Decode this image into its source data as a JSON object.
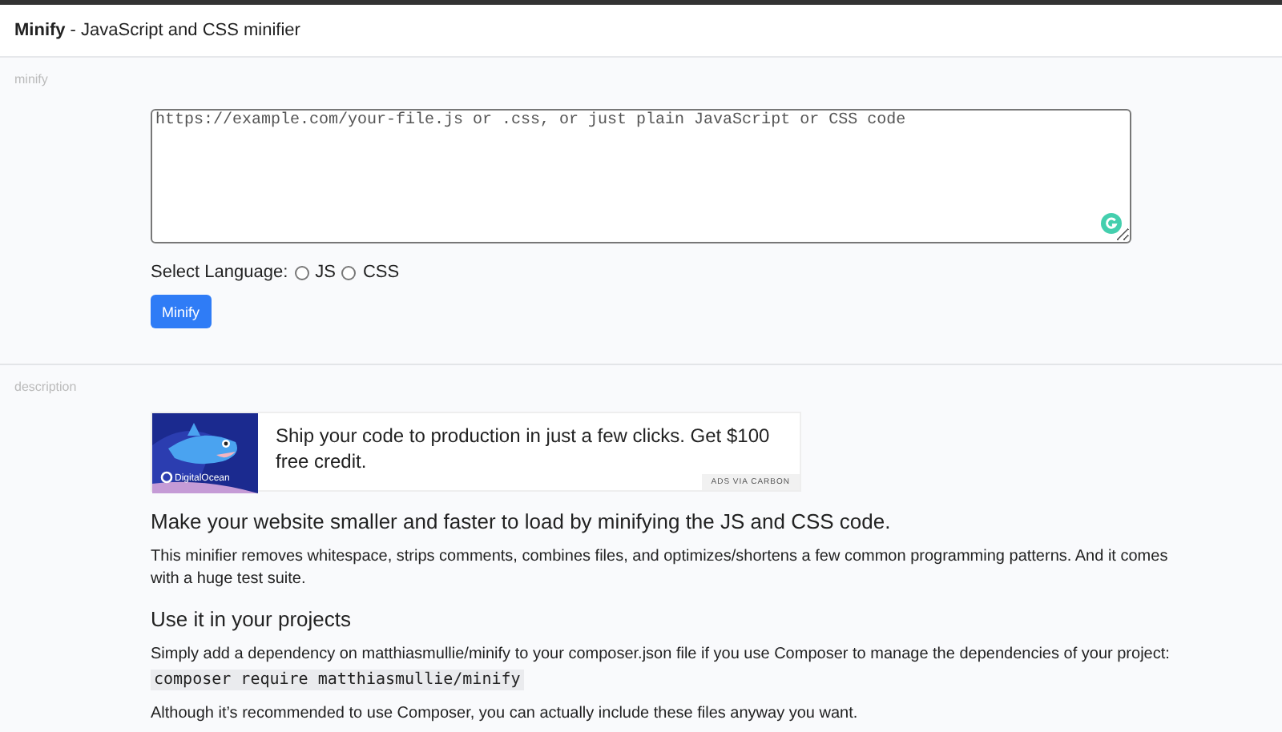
{
  "header": {
    "app_name": "Minify",
    "subtitle": "- JavaScript and CSS minifier"
  },
  "minify_section": {
    "label": "minify",
    "code_input": {
      "placeholder": "https://example.com/your-file.js or .css, or just plain JavaScript or CSS code"
    },
    "language": {
      "label": "Select Language:",
      "options": [
        {
          "label": "JS",
          "selected": false
        },
        {
          "label": "CSS",
          "selected": false
        }
      ]
    },
    "submit_button": "Minify"
  },
  "description_section": {
    "label": "description",
    "ad": {
      "brand": "DigitalOcean",
      "text": "Ship your code to production in just a few clicks. Get $100 free credit.",
      "badge": "ADS VIA CARBON"
    },
    "content": [
      {
        "kind": "heading",
        "text": "Make your website smaller and faster to load by minifying the JS and CSS code."
      },
      {
        "kind": "paragraph",
        "text": "This minifier removes whitespace, strips comments, combines files, and optimizes/shortens a few common programming patterns. And it comes with a huge test suite."
      },
      {
        "kind": "subheading",
        "text": "Use it in your projects"
      },
      {
        "kind": "paragraph",
        "text": "Simply add a dependency on matthiasmullie/minify to your composer.json file if you use Composer to manage the dependencies of your project:"
      },
      {
        "kind": "code",
        "text": "composer require matthiasmullie/minify"
      },
      {
        "kind": "paragraph",
        "text": "Although it’s recommended to use Composer, you can actually include these files anyway you want."
      }
    ]
  }
}
